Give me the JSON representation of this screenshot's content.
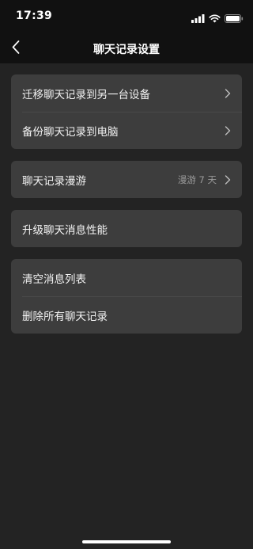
{
  "status_bar": {
    "time": "17:39",
    "icons": [
      "signal-icon",
      "wifi-icon",
      "battery-icon"
    ]
  },
  "nav": {
    "back_icon": "chevron-left-icon",
    "title": "聊天记录设置"
  },
  "groups": [
    {
      "rows": [
        {
          "label": "迁移聊天记录到另一台设备",
          "value": "",
          "chevron": true
        },
        {
          "label": "备份聊天记录到电脑",
          "value": "",
          "chevron": true
        }
      ]
    },
    {
      "rows": [
        {
          "label": "聊天记录漫游",
          "value": "漫游 7 天",
          "chevron": true
        }
      ]
    },
    {
      "rows": [
        {
          "label": "升级聊天消息性能",
          "value": "",
          "chevron": false
        }
      ]
    },
    {
      "rows": [
        {
          "label": "清空消息列表",
          "value": "",
          "chevron": false
        },
        {
          "label": "删除所有聊天记录",
          "value": "",
          "chevron": false
        }
      ]
    }
  ],
  "colors": {
    "background": "#232323",
    "header": "#111111",
    "card": "#3d3d3d",
    "text": "#f2f2f2",
    "secondary_text": "#9a9a9a"
  }
}
